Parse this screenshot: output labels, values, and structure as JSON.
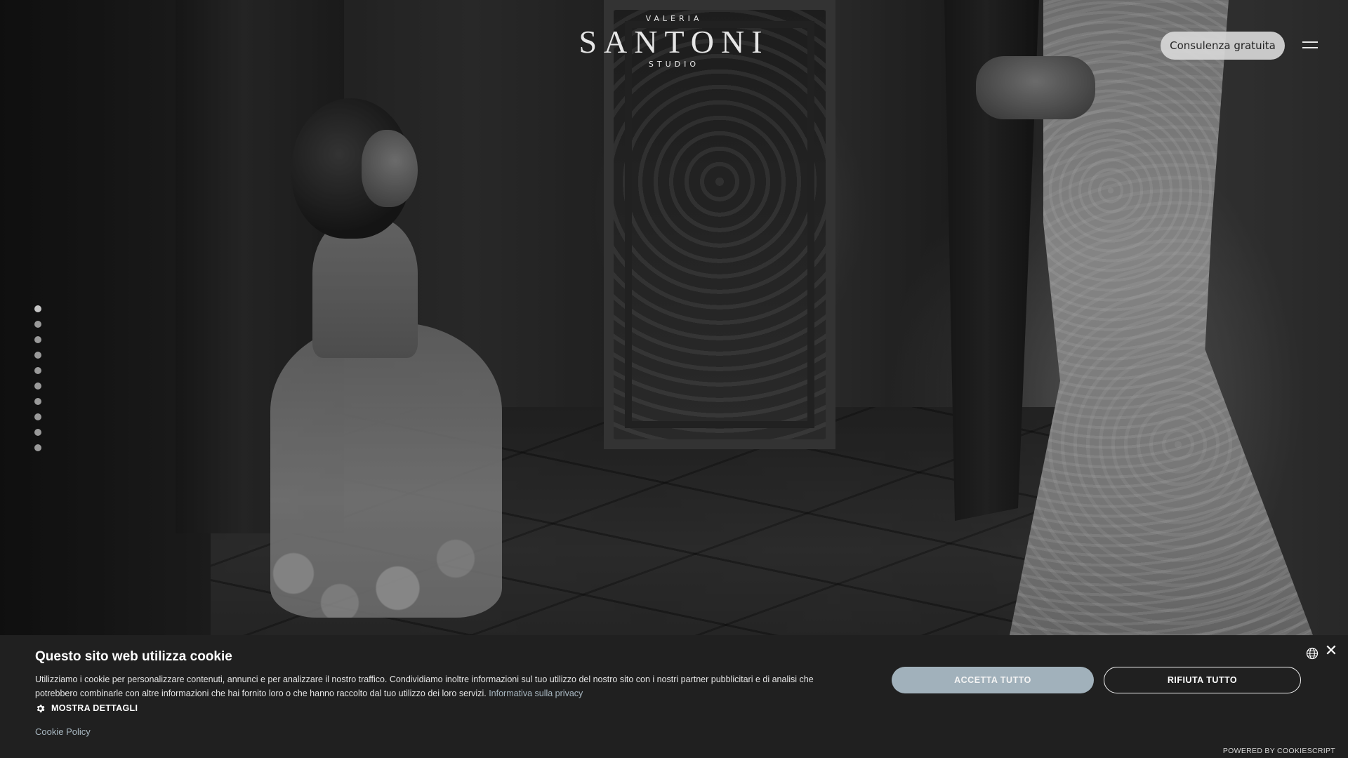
{
  "header": {
    "logo": {
      "top": "VALERIA",
      "main": "SANTONI",
      "bottom": "STUDIO"
    },
    "cta_label": "Consulenza gratuita",
    "menu_icon": "hamburger-menu-icon"
  },
  "hero": {
    "slide_count": 10,
    "active_slide": 1
  },
  "cookie_banner": {
    "title": "Questo sito web utilizza cookie",
    "text": "Utilizziamo i cookie per personalizzare contenuti, annunci e per analizzare il nostro traffico. Condividiamo inoltre informazioni sul tuo utilizzo del nostro sito con i nostri partner pubblicitari e di analisi che potrebbero combinarle con altre informazioni che hai fornito loro o che hanno raccolto dal tuo utilizzo dei loro servizi.",
    "privacy_link": "Informativa sulla privacy",
    "details_label": "MOSTRA DETTAGLI",
    "policy_link": "Cookie Policy",
    "accept_label": "ACCETTA TUTTO",
    "reject_label": "RIFIUTA TUTTO",
    "powered_by": "POWERED BY COOKIESCRIPT",
    "language_icon": "globe-icon",
    "close_icon": "close-icon",
    "details_icon": "gear-icon"
  },
  "colors": {
    "banner_bg": "#202020",
    "accept_bg": "#a1b1bb",
    "link": "#a9b8c2",
    "cta_bg": "#dadada"
  }
}
